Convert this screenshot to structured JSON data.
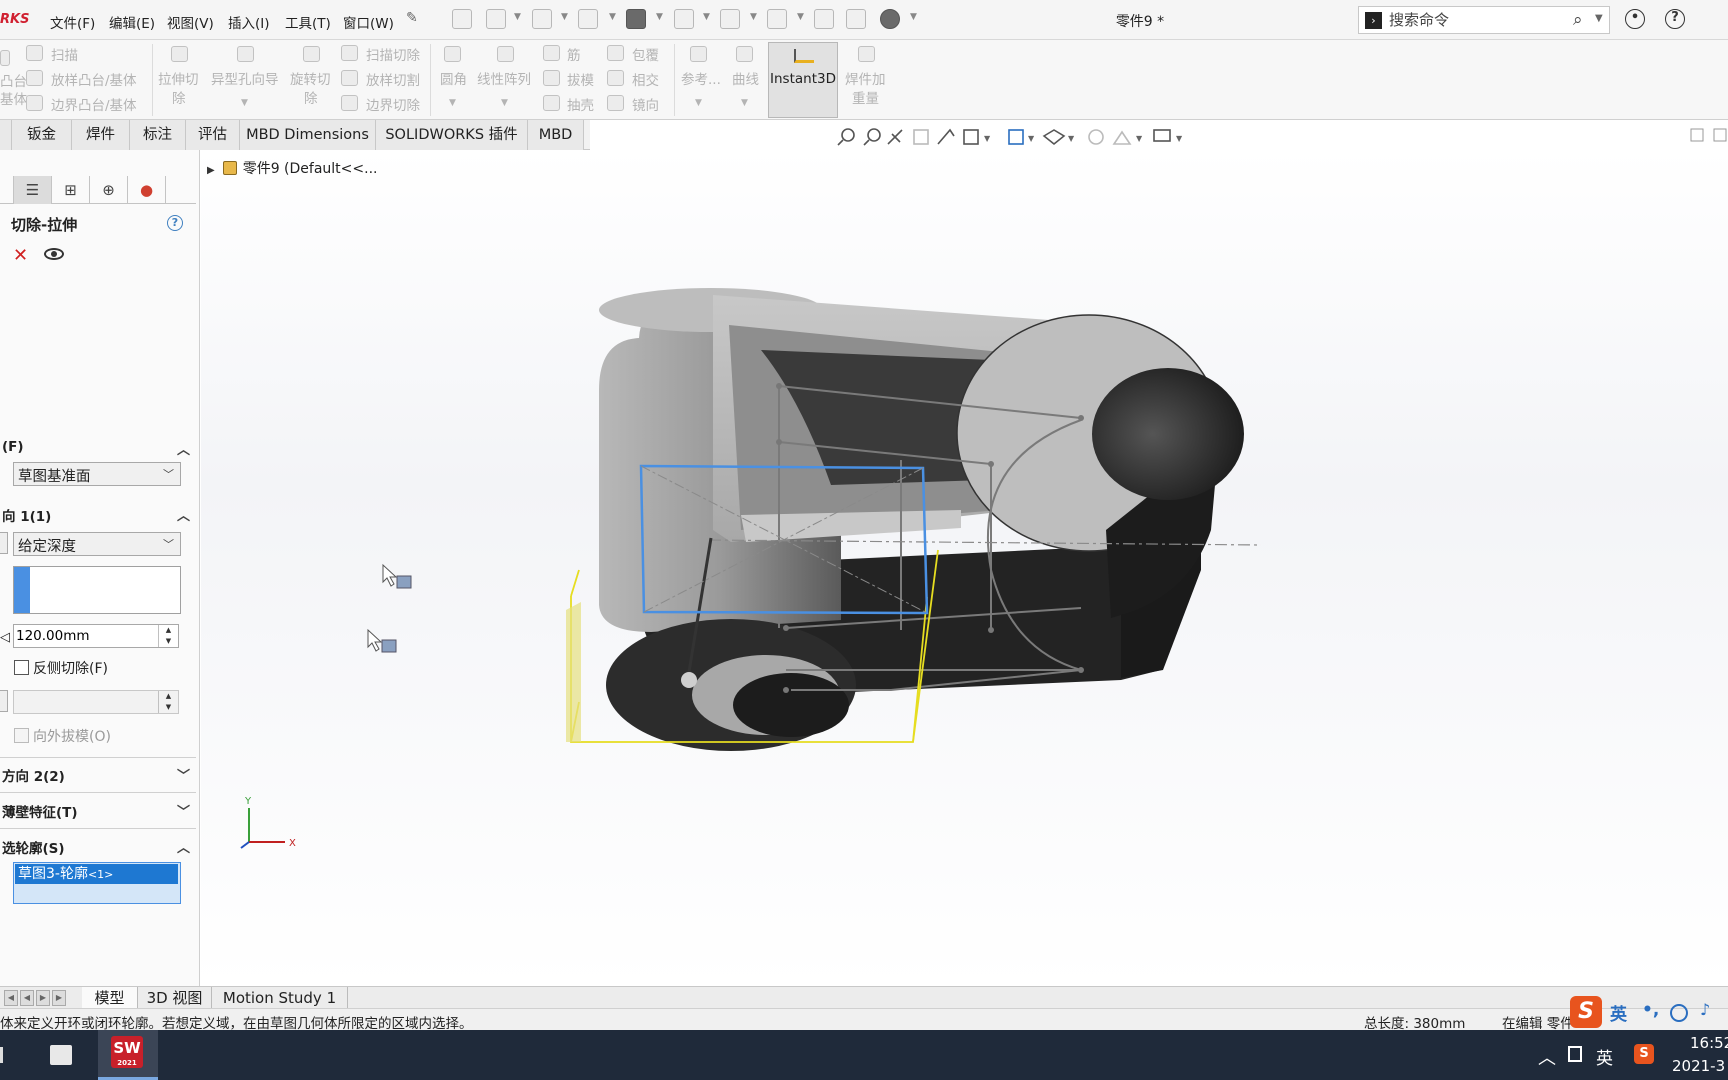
{
  "app": {
    "logo_text": "RKS"
  },
  "menu": [
    {
      "label": "文件(F)"
    },
    {
      "label": "编辑(E)"
    },
    {
      "label": "视图(V)"
    },
    {
      "label": "插入(I)"
    },
    {
      "label": "工具(T)"
    },
    {
      "label": "窗口(W)"
    }
  ],
  "window": {
    "title": "零件9 *"
  },
  "search": {
    "placeholder": "搜索命令"
  },
  "ribbon": {
    "sweep": "扫描",
    "loft_boss": "放样凸台/基体",
    "boundary_boss": "边界凸台/基体",
    "boss_line1": "凸台",
    "boss_line2": "基体",
    "extruded_cut_line1": "拉伸切",
    "extruded_cut_line2": "除",
    "hole_wizard": "异型孔向导",
    "revolved_cut_line1": "旋转切",
    "revolved_cut_line2": "除",
    "swept_cut": "扫描切除",
    "lofted_cut": "放样切割",
    "boundary_cut": "边界切除",
    "fillet": "圆角",
    "linear_pattern": "线性阵列",
    "rib": "筋",
    "draft": "拔模",
    "shell": "抽壳",
    "wrap": "包覆",
    "intersect": "相交",
    "mirror": "镜向",
    "reference": "参考...",
    "curves": "曲线",
    "instant3d": "Instant3D",
    "weld_bead_line1": "焊件加",
    "weld_bead_line2": "重量"
  },
  "tabs": [
    {
      "label": "钣金"
    },
    {
      "label": "焊件"
    },
    {
      "label": "标注"
    },
    {
      "label": "评估"
    },
    {
      "label": "MBD Dimensions"
    },
    {
      "label": "SOLIDWORKS 插件"
    },
    {
      "label": "MBD"
    }
  ],
  "feature_tree": {
    "root_label": "零件9  (Default<<..."
  },
  "property_manager": {
    "title": "切除-拉伸",
    "from_section": "(F)",
    "from_value": "草图基准面",
    "direction1_section": "向 1(1)",
    "end_condition": "给定深度",
    "depth_value": "120.00mm",
    "flip_side_cut": "反侧切除(F)",
    "draft_outward": "向外拔模(O)",
    "direction2_section": "方向 2(2)",
    "thin_feature_section": "薄壁特征(T)",
    "selected_contours_section": "选轮廓(S)",
    "contour_item": "草图3-轮廓",
    "contour_item_suffix": "<1>"
  },
  "bottom_tabs": [
    {
      "label": "模型"
    },
    {
      "label": "3D 视图"
    },
    {
      "label": "Motion Study 1"
    }
  ],
  "statusbar": {
    "message": "体来定义开环或闭环轮廓。若想定义域，在由草图几何体所限定的区域内选择。",
    "total_length": "总长度: 380mm",
    "editing": "在编辑 零件"
  },
  "ime": {
    "logo": "S",
    "lang": "英",
    "punct": "•,"
  },
  "triad": {
    "y_label": "Y",
    "x_label": "X"
  },
  "taskbar": {
    "sw_label": "SW",
    "sw_year": "2021",
    "tray_lang": "英",
    "tray_s": "S",
    "time": "16:52",
    "date": "2021-3"
  },
  "colors": {
    "sw_red": "#c8202a",
    "selection_blue": "#1e78d2",
    "preview_yellow": "#f0e020",
    "sketch_blue": "#4a90e2"
  }
}
